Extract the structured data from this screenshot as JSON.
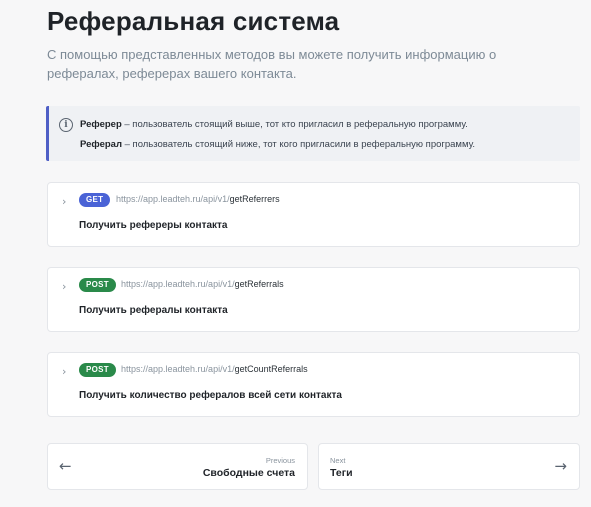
{
  "page": {
    "title": "Реферальная система",
    "subtitle": "С помощью представленных методов вы можете получить информацию о рефералах, реферерах вашего контакта."
  },
  "info": {
    "icon": "info-circle-icon",
    "line1_term": "Реферер",
    "line1_text": " – пользователь стоящий выше, тот кто пригласил в реферальную программу.",
    "line2_term": "Реферал",
    "line2_text": " – пользователь стоящий ниже, тот кого пригласили в реферальную программу."
  },
  "endpoints": [
    {
      "method": "GET",
      "base_url": "https://app.leadteh.ru/api/v1/",
      "path": "getReferrers",
      "description": "Получить рефереры контакта"
    },
    {
      "method": "POST",
      "base_url": "https://app.leadteh.ru/api/v1/",
      "path": "getReferrals",
      "description": "Получить рефералы контакта"
    },
    {
      "method": "POST",
      "base_url": "https://app.leadteh.ru/api/v1/",
      "path": "getCountReferrals",
      "description": "Получить количество рефералов всей сети контакта"
    }
  ],
  "pagination": {
    "prev_caption": "Previous",
    "prev_title": "Свободные счета",
    "next_caption": "Next",
    "next_title": "Теги"
  },
  "colors": {
    "get_badge": "#4a63d6",
    "post_badge": "#2a8a4a",
    "info_accent": "#4f5fc6"
  }
}
